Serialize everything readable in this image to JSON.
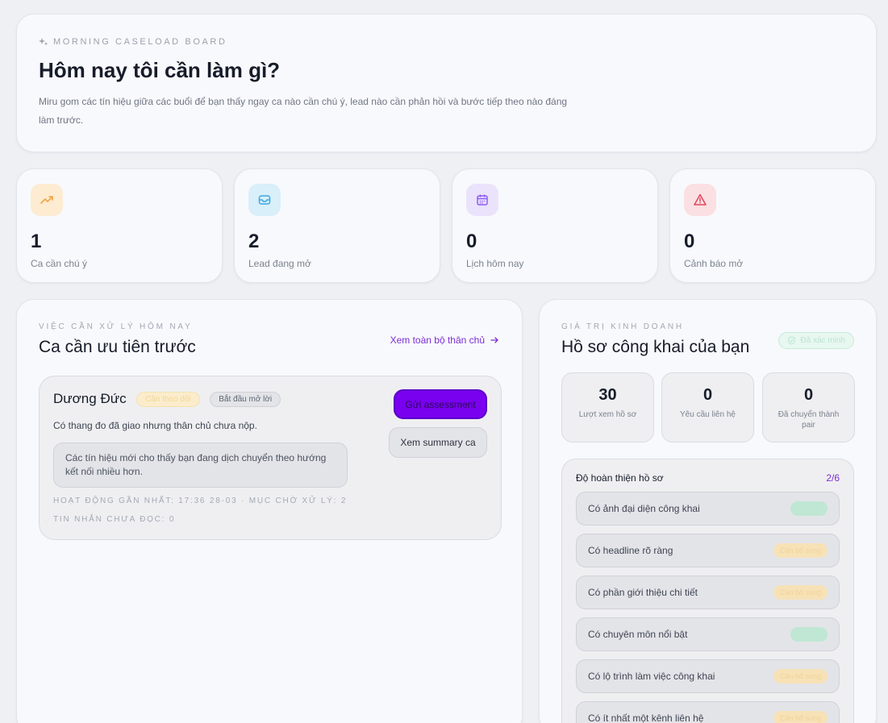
{
  "hero": {
    "eyebrow": "MORNING CASELOAD BOARD",
    "title": "Hôm nay tôi cần làm gì?",
    "description": "Miru gom các tín hiệu giữa các buổi để bạn thấy ngay ca nào cần chú ý, lead nào cần phản hồi và bước tiếp theo nào đáng làm trước."
  },
  "stats": [
    {
      "value": "1",
      "label": "Ca cần chú ý",
      "icon": "trend-up-icon",
      "color": "#f0a640"
    },
    {
      "value": "2",
      "label": "Lead đang mở",
      "icon": "inbox-icon",
      "color": "#3ba7e0"
    },
    {
      "value": "0",
      "label": "Lịch hôm nay",
      "icon": "calendar-icon",
      "color": "#8b5cf0"
    },
    {
      "value": "0",
      "label": "Cảnh báo mở",
      "icon": "alert-icon",
      "color": "#e0455a"
    }
  ],
  "today": {
    "eyebrow": "VIỆC CẦN XỬ LÝ HÔM NAY",
    "title": "Ca cần ưu tiên trước",
    "see_all": "Xem toàn bộ thân chủ",
    "case": {
      "name": "Dương Đức",
      "badge_priority": "Cần theo dõi",
      "badge_status": "Bắt đầu mở lời",
      "description": "Có thang đo đã giao nhưng thân chủ chưa nộp.",
      "signal": "Các tín hiệu mới cho thấy bạn đang dịch chuyển theo hướng kết nối nhiều hơn.",
      "meta_line1": "HOẠT ĐỘNG GẦN NHẤT: 17:36 28-03 · MỤC CHỜ XỬ LÝ: 2",
      "meta_line2": "TIN NHẮN CHƯA ĐỌC: 0",
      "primary_action": "Gửi assessment",
      "secondary_action": "Xem summary ca"
    }
  },
  "business": {
    "eyebrow": "GIÁ TRỊ KINH DOANH",
    "title": "Hồ sơ công khai của bạn",
    "verified_label": "Đã xác minh",
    "metrics": [
      {
        "value": "30",
        "label": "Lượt xem hồ sơ"
      },
      {
        "value": "0",
        "label": "Yêu cầu liên hệ"
      },
      {
        "value": "0",
        "label": "Đã chuyển thành pair"
      }
    ],
    "completeness": {
      "title": "Độ hoàn thiện hồ sơ",
      "count": "2/6",
      "items": [
        {
          "label": "Có ảnh đại diện công khai",
          "status": "Đã có",
          "ok": true
        },
        {
          "label": "Có headline rõ ràng",
          "status": "Cần bổ sung",
          "ok": false
        },
        {
          "label": "Có phần giới thiệu chi tiết",
          "status": "Cần bổ sung",
          "ok": false
        },
        {
          "label": "Có chuyên môn nổi bật",
          "status": "Đã có",
          "ok": true
        },
        {
          "label": "Có lộ trình làm việc công khai",
          "status": "Cần bổ sung",
          "ok": false
        },
        {
          "label": "Có ít nhất một kênh liên hệ",
          "status": "Cần bổ sung",
          "ok": false
        }
      ]
    }
  }
}
